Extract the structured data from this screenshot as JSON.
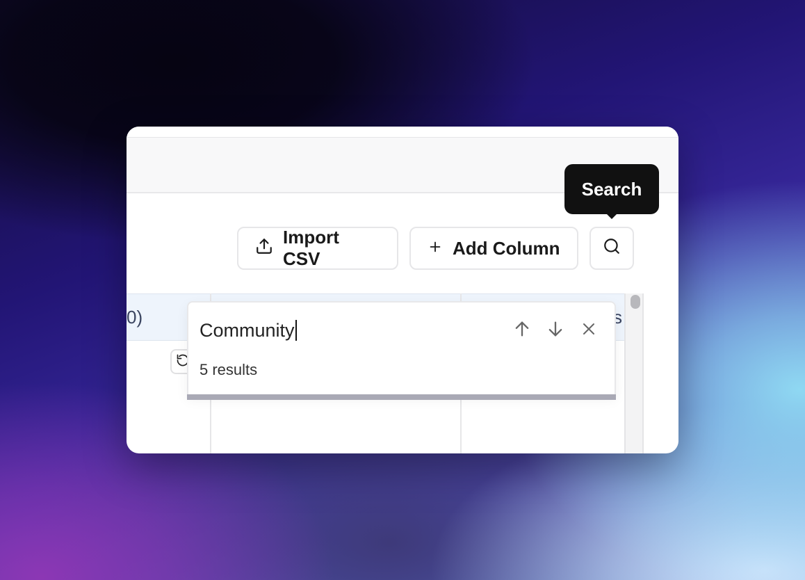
{
  "toolbar": {
    "import_label": "Import CSV",
    "add_column_label": "Add Column",
    "search_icon": "search-icon",
    "upload_icon": "upload-icon",
    "plus_icon": "plus-icon"
  },
  "tooltip": {
    "text": "Search"
  },
  "grid": {
    "header_left_fragment": "0)",
    "header_right_fragment": "s"
  },
  "search_panel": {
    "query": "Community",
    "results_text": "5 results",
    "prev_icon": "arrow-up-icon",
    "next_icon": "arrow-down-icon",
    "close_icon": "close-icon"
  },
  "colors": {
    "tooltip_bg": "#111111",
    "header_row_bg": "#eef4fc",
    "progress_bar": "#a9a9b5"
  }
}
